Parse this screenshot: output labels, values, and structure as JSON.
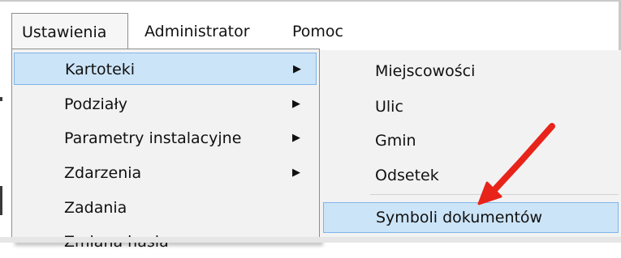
{
  "menubar": {
    "items": [
      {
        "label": "Ustawienia"
      },
      {
        "label": "Administrator"
      },
      {
        "label": "Pomoc"
      }
    ]
  },
  "menu": {
    "items": [
      {
        "label": "Kartoteki",
        "has_submenu": true
      },
      {
        "label": "Podziały",
        "has_submenu": true
      },
      {
        "label": "Parametry instalacyjne",
        "has_submenu": true
      },
      {
        "label": "Zdarzenia",
        "has_submenu": true
      },
      {
        "label": "Zadania",
        "has_submenu": false
      },
      {
        "label": "Zmiana hasła",
        "has_submenu": false
      }
    ],
    "submenu_arrow": "▶"
  },
  "submenu": {
    "items": [
      {
        "label": "Miejscowości"
      },
      {
        "label": "Ulic"
      },
      {
        "label": "Gmin"
      },
      {
        "label": "Odsetek"
      },
      {
        "label": "Symboli dokumentów"
      }
    ]
  },
  "colors": {
    "highlight_fill": "#cce4f7",
    "highlight_border": "#7eb4ea",
    "annotation_arrow": "#e8231a"
  },
  "annotation": {
    "icon": "red-arrow-icon"
  }
}
